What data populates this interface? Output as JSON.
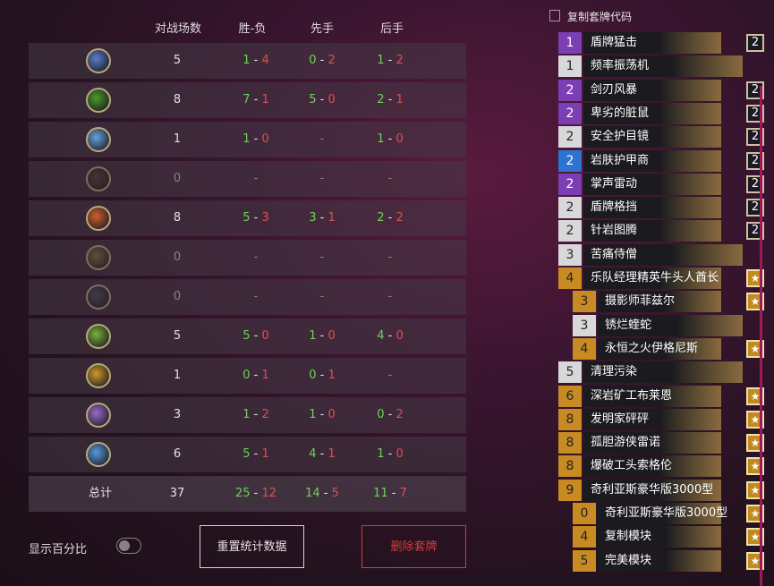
{
  "headers": {
    "games": "对战场数",
    "win_loss": "胜-负",
    "first": "先手",
    "second": "后手"
  },
  "rows": [
    {
      "icon": "mage-class-icon",
      "color": "#5a7cc8",
      "games": "5",
      "w": "1",
      "l": "4",
      "fw": "0",
      "fl": "2",
      "sw": "1",
      "sl": "2",
      "active": true
    },
    {
      "icon": "warlock-class-icon",
      "color": "#4a9a2a",
      "games": "8",
      "w": "7",
      "l": "1",
      "fw": "5",
      "fl": "0",
      "sw": "2",
      "sl": "1",
      "active": true
    },
    {
      "icon": "shaman-class-icon",
      "color": "#6aa0d8",
      "games": "1",
      "w": "1",
      "l": "0",
      "fw": "-",
      "fl": "",
      "sw": "1",
      "sl": "0",
      "active": true
    },
    {
      "icon": "demon-hunter-class-icon",
      "color": "#5a3a30",
      "games": "0",
      "w": "-",
      "l": "",
      "fw": "-",
      "fl": "",
      "sw": "-",
      "sl": "",
      "active": false
    },
    {
      "icon": "warrior-class-icon",
      "color": "#d0602a",
      "games": "8",
      "w": "5",
      "l": "3",
      "fw": "3",
      "fl": "1",
      "sw": "2",
      "sl": "2",
      "active": true
    },
    {
      "icon": "hunter-class-icon",
      "color": "#8a6a3a",
      "games": "0",
      "w": "-",
      "l": "",
      "fw": "-",
      "fl": "",
      "sw": "-",
      "sl": "",
      "active": false
    },
    {
      "icon": "rogue-class-icon",
      "color": "#4a4a58",
      "games": "0",
      "w": "-",
      "l": "",
      "fw": "-",
      "fl": "",
      "sw": "-",
      "sl": "",
      "active": false
    },
    {
      "icon": "druid-class-icon",
      "color": "#7ab03a",
      "games": "5",
      "w": "5",
      "l": "0",
      "fw": "1",
      "fl": "0",
      "sw": "4",
      "sl": "0",
      "active": true
    },
    {
      "icon": "paladin-class-icon",
      "color": "#d09a2a",
      "games": "1",
      "w": "0",
      "l": "1",
      "fw": "0",
      "fl": "1",
      "sw": "-",
      "sl": "",
      "active": true
    },
    {
      "icon": "priest-class-icon",
      "color": "#9a6ac8",
      "games": "3",
      "w": "1",
      "l": "2",
      "fw": "1",
      "fl": "0",
      "sw": "0",
      "sl": "2",
      "active": true
    },
    {
      "icon": "death-knight-class-icon",
      "color": "#5a9ad8",
      "games": "6",
      "w": "5",
      "l": "1",
      "fw": "4",
      "fl": "1",
      "sw": "1",
      "sl": "0",
      "active": true
    }
  ],
  "total": {
    "label": "总计",
    "games": "37",
    "w": "25",
    "l": "12",
    "fw": "14",
    "fl": "5",
    "sw": "11",
    "sl": "7"
  },
  "toggle_label": "显示百分比",
  "reset_button": "重置统计数据",
  "delete_button": "删除套牌",
  "copy_label": "复制套牌代码",
  "deck": [
    {
      "cost": "1",
      "name": "盾牌猛击",
      "rarity": "purple",
      "badge": "2"
    },
    {
      "cost": "1",
      "name": "频率振荡机",
      "rarity": "white",
      "badge": ""
    },
    {
      "cost": "2",
      "name": "剑刃风暴",
      "rarity": "purple",
      "badge": "2"
    },
    {
      "cost": "2",
      "name": "卑劣的脏鼠",
      "rarity": "purple",
      "badge": "2"
    },
    {
      "cost": "2",
      "name": "安全护目镜",
      "rarity": "white",
      "badge": "2"
    },
    {
      "cost": "2",
      "name": "岩肤护甲商",
      "rarity": "blue",
      "badge": "2"
    },
    {
      "cost": "2",
      "name": "掌声雷动",
      "rarity": "purple",
      "badge": "2"
    },
    {
      "cost": "2",
      "name": "盾牌格挡",
      "rarity": "white",
      "badge": "2"
    },
    {
      "cost": "2",
      "name": "针岩图腾",
      "rarity": "white",
      "badge": "2"
    },
    {
      "cost": "3",
      "name": "苦痛侍僧",
      "rarity": "white",
      "badge": ""
    },
    {
      "cost": "4",
      "name": "乐队经理精英牛头人酋长",
      "rarity": "gold",
      "badge": "★"
    },
    {
      "cost": "3",
      "name": "摄影师菲兹尔",
      "rarity": "gold",
      "badge": "★",
      "indent": true
    },
    {
      "cost": "3",
      "name": "锈烂蝰蛇",
      "rarity": "white",
      "badge": "",
      "indent": true
    },
    {
      "cost": "4",
      "name": "永恒之火伊格尼斯",
      "rarity": "gold",
      "badge": "★",
      "indent": true
    },
    {
      "cost": "5",
      "name": "清理污染",
      "rarity": "white",
      "badge": ""
    },
    {
      "cost": "6",
      "name": "深岩矿工布莱恩",
      "rarity": "gold",
      "badge": "★"
    },
    {
      "cost": "8",
      "name": "发明家砰砰",
      "rarity": "gold",
      "badge": "★"
    },
    {
      "cost": "8",
      "name": "孤胆游侠雷诺",
      "rarity": "gold",
      "badge": "★"
    },
    {
      "cost": "8",
      "name": "爆破工头索格伦",
      "rarity": "gold",
      "badge": "★"
    },
    {
      "cost": "9",
      "name": "奇利亚斯豪华版3000型",
      "rarity": "gold",
      "badge": "★"
    },
    {
      "cost": "0",
      "name": "奇利亚斯豪华版3000型",
      "rarity": "gold",
      "badge": "★",
      "indent": true
    },
    {
      "cost": "4",
      "name": "复制模块",
      "rarity": "gold",
      "badge": "★",
      "indent": true
    },
    {
      "cost": "5",
      "name": "完美模块",
      "rarity": "gold",
      "badge": "★",
      "indent": true
    }
  ]
}
